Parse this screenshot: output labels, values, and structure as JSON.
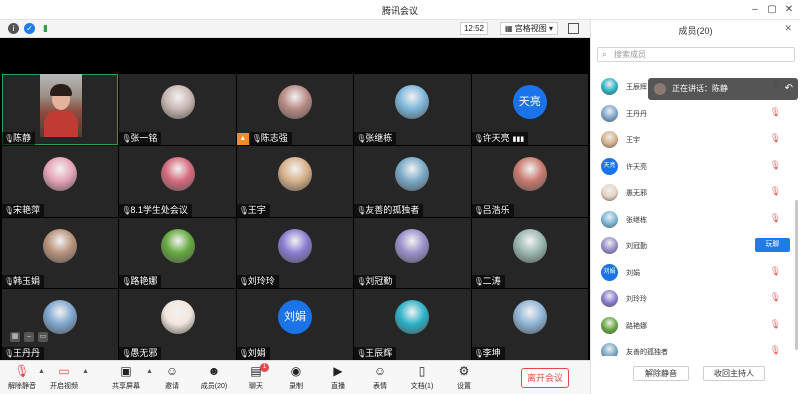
{
  "window": {
    "title": "腾讯会议"
  },
  "topbar": {
    "time": "12:52",
    "view_label": "宫格视图"
  },
  "tiles": [
    {
      "name": "陈静",
      "type": "video"
    },
    {
      "name": "张一铭",
      "type": "photo",
      "color": "#c9b7b3"
    },
    {
      "name": "陈志强",
      "type": "photo",
      "color": "#b88a83",
      "sharing": true
    },
    {
      "name": "张继栋",
      "type": "photo",
      "color": "#7cb6da"
    },
    {
      "name": "许天亮",
      "type": "text",
      "avatar_text": "天亮",
      "signal": true
    },
    {
      "name": "宋艳萍",
      "type": "photo",
      "color": "#e7a4b8"
    },
    {
      "name": "8.1学生处会议",
      "type": "photo",
      "color": "#d56a7d"
    },
    {
      "name": "王宇",
      "type": "photo",
      "color": "#d7b189"
    },
    {
      "name": "友善的孤独者",
      "type": "photo",
      "color": "#7aa9c7"
    },
    {
      "name": "吕浩乐",
      "type": "photo",
      "color": "#c97a6e"
    },
    {
      "name": "韩玉娟",
      "type": "photo",
      "color": "#b9927a"
    },
    {
      "name": "路艳娜",
      "type": "photo",
      "color": "#64a83c"
    },
    {
      "name": "刘玲玲",
      "type": "photo",
      "color": "#8a7bd1"
    },
    {
      "name": "刘冠勤",
      "type": "photo",
      "color": "#9a8fc9"
    },
    {
      "name": "二涛",
      "type": "photo",
      "color": "#9ab6b0"
    },
    {
      "name": "王丹丹",
      "type": "photo",
      "color": "#7fa6cf"
    },
    {
      "name": "愚无邪",
      "type": "photo",
      "color": "#f2e7de"
    },
    {
      "name": "刘娟",
      "type": "text",
      "avatar_text": "刘娟"
    },
    {
      "name": "王辰辉",
      "type": "photo",
      "color": "#2bb3c8"
    },
    {
      "name": "李坤",
      "type": "photo",
      "color": "#8fb5d6"
    }
  ],
  "toolbar": {
    "mute": "解除静音",
    "video": "开启视频",
    "share": "共享屏幕",
    "invite": "邀请",
    "members": "成员(20)",
    "chat": "聊天",
    "chat_badge": "1",
    "record": "录制",
    "live": "直播",
    "reaction": "表情",
    "docs": "文档(1)",
    "settings": "设置",
    "leave": "离开会议"
  },
  "panel": {
    "title": "成员(20)",
    "search_placeholder": "搜索成员",
    "speaking_label": "正在讲话：陈静",
    "unmute_chip": "玩聊",
    "members": [
      {
        "name": "王辰辉",
        "color": "#2bb3c8"
      },
      {
        "name": "王丹丹",
        "color": "#7fa6cf"
      },
      {
        "name": "王宇",
        "color": "#d7b189"
      },
      {
        "name": "许天亮",
        "color": "#1a73e8",
        "avatar_text": "天亮"
      },
      {
        "name": "愚无邪",
        "color": "#e9d4c4"
      },
      {
        "name": "张继栋",
        "color": "#7cb6da"
      },
      {
        "name": "刘冠勤",
        "color": "#9a8fc9"
      },
      {
        "name": "刘娟",
        "color": "#1a73e8",
        "avatar_text": "刘娟"
      },
      {
        "name": "刘玲玲",
        "color": "#8a7bd1"
      },
      {
        "name": "路艳娜",
        "color": "#64a83c"
      },
      {
        "name": "友善的孤独者",
        "color": "#7aa9c7"
      }
    ],
    "btn_unmute_all": "解除静音",
    "btn_reclaim_host": "收回主持人"
  }
}
